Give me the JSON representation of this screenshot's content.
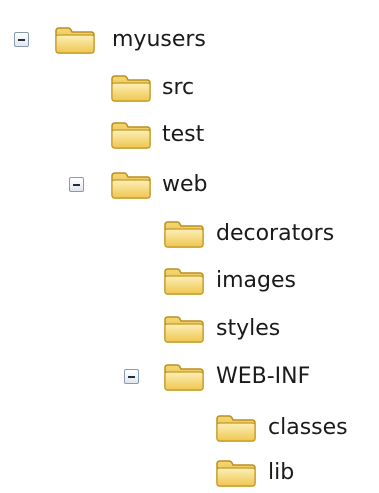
{
  "tree": {
    "root": {
      "label": "myusers",
      "icon": "folder-open-icon",
      "toggle": "minus",
      "children": {
        "src": {
          "label": "src",
          "icon": "folder-icon"
        },
        "test": {
          "label": "test",
          "icon": "folder-icon"
        },
        "web": {
          "label": "web",
          "icon": "folder-open-icon",
          "toggle": "minus",
          "children": {
            "decorators": {
              "label": "decorators",
              "icon": "folder-icon"
            },
            "images": {
              "label": "images",
              "icon": "folder-icon"
            },
            "styles": {
              "label": "styles",
              "icon": "folder-icon"
            },
            "webinf": {
              "label": "WEB-INF",
              "icon": "folder-open-icon",
              "toggle": "minus",
              "children": {
                "classes": {
                  "label": "classes",
                  "icon": "folder-icon"
                },
                "lib": {
                  "label": "lib",
                  "icon": "folder-icon"
                }
              }
            }
          }
        }
      }
    }
  },
  "colors": {
    "folder_body": "#f3cf5c",
    "folder_light": "#fbe9a6",
    "folder_stroke": "#b8901e",
    "text": "#1a1a1a",
    "toggle_border": "#8a9aae"
  }
}
